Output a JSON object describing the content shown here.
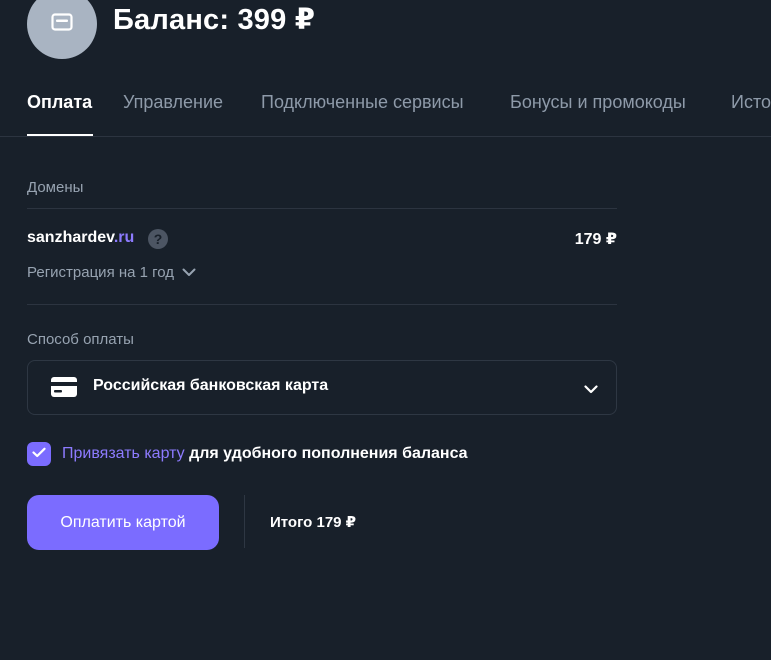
{
  "header": {
    "title": "Баланс: 399 ₽",
    "avatar_icon": "credit-card-icon"
  },
  "tabs": [
    {
      "label": "Оплата",
      "active": true
    },
    {
      "label": "Управление",
      "active": false
    },
    {
      "label": "Подключенные сервисы",
      "active": false
    },
    {
      "label": "Бонусы и промокоды",
      "active": false
    },
    {
      "label": "Исто",
      "active": false
    }
  ],
  "domains": {
    "section_label": "Домены",
    "item": {
      "name": "sanzhardev",
      "tld": ".ru",
      "help_icon": "question-icon",
      "price": "179 ₽",
      "period": "Регистрация на 1 год"
    }
  },
  "payment": {
    "section_label": "Способ оплаты",
    "method": "Российская банковская карта",
    "method_icon": "bank-card-icon"
  },
  "bind_card": {
    "checked": true,
    "link_text": "Привязать карту",
    "rest_text": " для удобного пополнения баланса"
  },
  "footer": {
    "pay_label": "Оплатить картой",
    "total": "Итого 179 ₽"
  },
  "colors": {
    "background": "#18202a",
    "accent": "#7b6cff",
    "link": "#8d7bff",
    "muted_text": "#97a3b1",
    "avatar": "#a9b4c2"
  }
}
